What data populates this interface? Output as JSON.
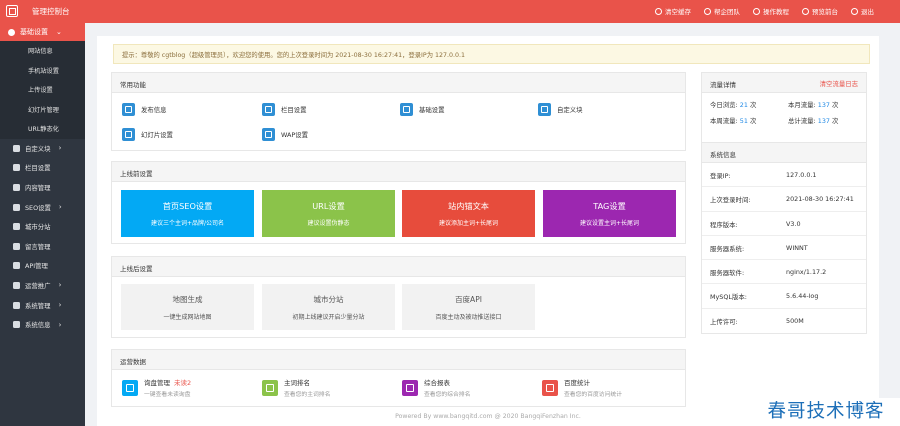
{
  "header": {
    "title": "管理控制台",
    "nav": [
      {
        "label": "清空缓存",
        "icon": "clear-cache-icon"
      },
      {
        "label": "帮企团队",
        "icon": "team-icon"
      },
      {
        "label": "操作教程",
        "icon": "tutorial-icon"
      },
      {
        "label": "预览前台",
        "icon": "home-icon"
      },
      {
        "label": "退出",
        "icon": "logout-icon"
      }
    ]
  },
  "sidebar": {
    "active": {
      "label": "基础设置",
      "icon": "gear-icon"
    },
    "subitems": [
      "网站信息",
      "手机站设置",
      "上传设置",
      "幻灯片管理",
      "URL静态化"
    ],
    "items": [
      {
        "label": "自定义块",
        "icon": "tag-icon",
        "chevron": "›"
      },
      {
        "label": "栏目设置",
        "icon": "grid-icon",
        "chevron": ""
      },
      {
        "label": "内容管理",
        "icon": "folder-icon",
        "chevron": ""
      },
      {
        "label": "SEO设置",
        "icon": "chart-icon",
        "chevron": "›"
      },
      {
        "label": "城市分站",
        "icon": "globe-icon",
        "chevron": ""
      },
      {
        "label": "留言管理",
        "icon": "chat-icon",
        "chevron": ""
      },
      {
        "label": "API管理",
        "icon": "link-icon",
        "chevron": ""
      },
      {
        "label": "运营推广",
        "icon": "table-icon",
        "chevron": "›"
      },
      {
        "label": "系统管理",
        "icon": "monitor-icon",
        "chevron": "›"
      },
      {
        "label": "系统信息",
        "icon": "dashboard-icon",
        "chevron": "›"
      }
    ]
  },
  "notice": "提示：尊敬的 cgtblog（超级管理员），欢迎您的使用。您的上次登录时间为 2021-08-30 16:27:41，登录IP为 127.0.0.1",
  "common": {
    "title": "常用功能",
    "items": [
      {
        "label": "发布信息",
        "icon": "publish-icon"
      },
      {
        "label": "栏目设置",
        "icon": "column-icon"
      },
      {
        "label": "基础设置",
        "icon": "settings-icon"
      },
      {
        "label": "自定义块",
        "icon": "custom-block-icon"
      },
      {
        "label": "幻灯片设置",
        "icon": "slideshow-icon"
      },
      {
        "label": "WAP设置",
        "icon": "wap-icon"
      }
    ]
  },
  "prelaunch": {
    "title": "上线前设置",
    "buttons": [
      {
        "title": "首页SEO设置",
        "sub": "建议三个主词+品牌/公司名",
        "color": "#03a9f4"
      },
      {
        "title": "URL设置",
        "sub": "建议设置伪静态",
        "color": "#8bc34a"
      },
      {
        "title": "站内锚文本",
        "sub": "建议添加主词+长尾词",
        "color": "#e74c3c"
      },
      {
        "title": "TAG设置",
        "sub": "建议设置主词+长尾词",
        "color": "#9c27b0"
      }
    ]
  },
  "postlaunch": {
    "title": "上线后设置",
    "buttons": [
      {
        "title": "地图生成",
        "sub": "一键生成网站地图"
      },
      {
        "title": "城市分站",
        "sub": "初期上线建议开启少量分站"
      },
      {
        "title": "百度API",
        "sub": "百度主动及被动推送接口"
      }
    ]
  },
  "ops": {
    "title": "运营数据",
    "items": [
      {
        "title": "询盘管理",
        "badge": "未读2",
        "sub": "一键查看未读询盘",
        "color": "#03a9f4",
        "icon": "inbox-icon"
      },
      {
        "title": "主词排名",
        "badge": "",
        "sub": "查看您的主词排名",
        "color": "#8bc34a",
        "icon": "ranking-icon"
      },
      {
        "title": "综合报表",
        "badge": "",
        "sub": "查看您的综合排名",
        "color": "#9c27b0",
        "icon": "report-icon"
      },
      {
        "title": "百度统计",
        "badge": "",
        "sub": "查看您的百度访问统计",
        "color": "#e9534a",
        "icon": "stats-icon"
      }
    ]
  },
  "traffic": {
    "title": "流量详情",
    "clear_label": "清空流量日志",
    "today_label": "今日浏览:",
    "today_value": "21",
    "today_unit": "次",
    "month_label": "本月流量:",
    "month_value": "137",
    "month_unit": "次",
    "week_label": "本周流量:",
    "week_value": "51",
    "week_unit": "次",
    "total_label": "总计流量:",
    "total_value": "137",
    "total_unit": "次"
  },
  "system": {
    "title": "系统信息",
    "rows": [
      {
        "k": "登录IP:",
        "v": "127.0.0.1"
      },
      {
        "k": "上次登录时间:",
        "v": "2021-08-30 16:27:41"
      },
      {
        "k": "程序版本:",
        "v": "V3.0"
      },
      {
        "k": "服务器系统:",
        "v": "WINNT"
      },
      {
        "k": "服务器软件:",
        "v": "nginx/1.17.2"
      },
      {
        "k": "MySQL版本:",
        "v": "5.6.44-log"
      },
      {
        "k": "上传许可:",
        "v": "500M"
      }
    ]
  },
  "footer": "Powered By www.bangqitd.com @ 2020 BangqiFenzhan Inc.",
  "watermark": "春哥技术博客"
}
